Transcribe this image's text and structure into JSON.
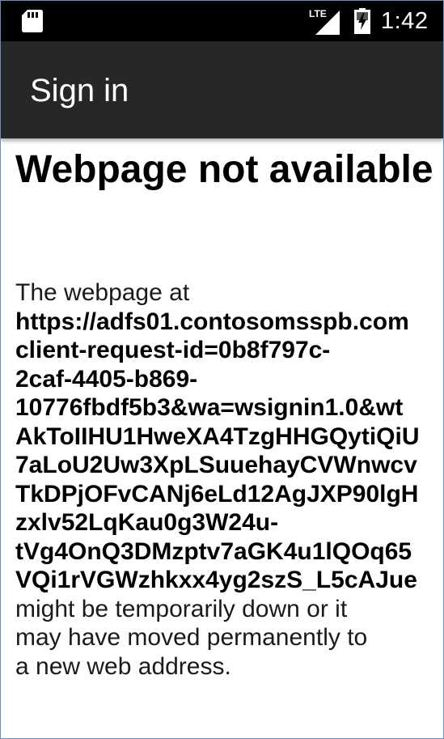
{
  "status_bar": {
    "time": "1:42",
    "network_label": "LTE",
    "icons": [
      "sd-card-icon",
      "lte-signal-icon",
      "battery-charging-icon"
    ]
  },
  "app_bar": {
    "title": "Sign in"
  },
  "error": {
    "title": "Webpage not available",
    "intro": "The webpage at",
    "url_lines": [
      "https://adfs01.contosomsspb.com",
      "client-request-id=0b8f797c-",
      "2caf-4405-b869-",
      "10776fbdf5b3&wa=wsignin1.0&wt",
      "AkToIIHU1HweXA4TzgHHGQytiQiU",
      "7aLoU2Uw3XpLSuuehayCVWnwcv",
      "TkDPjOFvCANj6eLd12AgJXP90lgH",
      "zxlv52LqKau0g3W24u-",
      "tVg4OnQ3DMzptv7aGK4u1lQOq65",
      "VQi1rVGWzhkxx4yg2szS_L5cAJue"
    ],
    "message_lines": [
      "might be temporarily down or it",
      "may have moved permanently to",
      "a new web address."
    ]
  },
  "colors": {
    "status_bar_bg": "#000000",
    "app_bar_bg": "#272727",
    "page_bg": "#ffffff",
    "text": "#000000"
  }
}
